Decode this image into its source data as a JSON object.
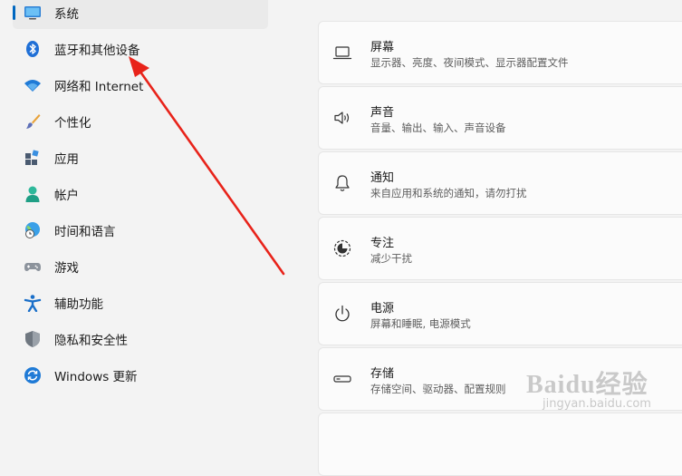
{
  "sidebar": {
    "items": [
      {
        "label": "系统",
        "icon": "monitor-icon"
      },
      {
        "label": "蓝牙和其他设备",
        "icon": "bluetooth-icon"
      },
      {
        "label": "网络和 Internet",
        "icon": "wifi-icon"
      },
      {
        "label": "个性化",
        "icon": "brush-icon"
      },
      {
        "label": "应用",
        "icon": "apps-icon"
      },
      {
        "label": "帐户",
        "icon": "person-icon"
      },
      {
        "label": "时间和语言",
        "icon": "globe-clock-icon"
      },
      {
        "label": "游戏",
        "icon": "gamepad-icon"
      },
      {
        "label": "辅助功能",
        "icon": "accessibility-icon"
      },
      {
        "label": "隐私和安全性",
        "icon": "shield-icon"
      },
      {
        "label": "Windows 更新",
        "icon": "update-icon"
      }
    ],
    "selected_index": 0
  },
  "cards": [
    {
      "title": "屏幕",
      "subtitle": "显示器、亮度、夜间模式、显示器配置文件",
      "icon": "laptop-icon"
    },
    {
      "title": "声音",
      "subtitle": "音量、输出、输入、声音设备",
      "icon": "speaker-icon"
    },
    {
      "title": "通知",
      "subtitle": "来自应用和系统的通知，请勿打扰",
      "icon": "bell-icon"
    },
    {
      "title": "专注",
      "subtitle": "减少干扰",
      "icon": "focus-icon"
    },
    {
      "title": "电源",
      "subtitle": "屏幕和睡眠, 电源模式",
      "icon": "power-icon"
    },
    {
      "title": "存储",
      "subtitle": "存储空间、驱动器、配置规则",
      "icon": "storage-icon"
    }
  ],
  "watermark": {
    "main": "Baidu经验",
    "sub": "jingyan.baidu.com"
  },
  "colors": {
    "accent": "#0067c0",
    "annotation_arrow": "#e8231a"
  }
}
